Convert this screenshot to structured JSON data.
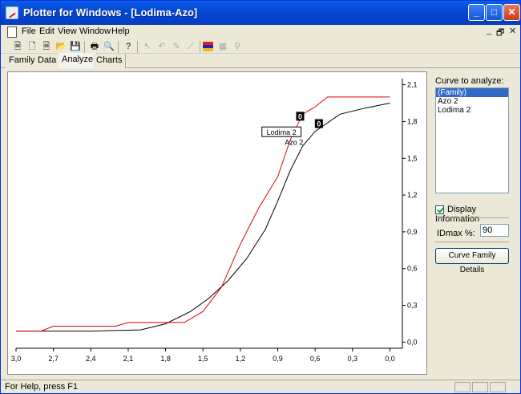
{
  "window": {
    "title": "Plotter for Windows - [Lodima-Azo]"
  },
  "titlebar_buttons": {
    "minimize": "_",
    "maximize": "□",
    "close": "✕"
  },
  "menu": [
    "File",
    "Edit",
    "View",
    "Window",
    "Help"
  ],
  "mdi_controls": [
    "_",
    "🗗",
    "✕"
  ],
  "toolbar_icons": [
    "new-family-icon",
    "new-icon",
    "new-sheet-icon",
    "open-icon",
    "save-icon",
    "print-icon",
    "print-preview-icon",
    "help-icon",
    "pointer-icon",
    "undo-icon",
    "add-point-icon",
    "draw-curve-icon",
    "color-palette-icon",
    "grid-icon",
    "zoom-icon"
  ],
  "tabs": [
    "Family",
    "Data",
    "Analyze",
    "Charts"
  ],
  "active_tab": "Analyze",
  "panel": {
    "curve_label": "Curve to analyze:",
    "curves": [
      "(Family)",
      "Azo 2",
      "Lodima 2"
    ],
    "selected_curve": "(Family)",
    "display_info_label": "Display Information",
    "display_info_checked": true,
    "idmax_label": "IDmax %:",
    "idmax_value": "90",
    "details_button": "Curve Family Details"
  },
  "status": {
    "text": "For Help, press F1"
  },
  "colors": {
    "title_blue": "#0548d4",
    "series_black": "#000000",
    "series_red": "#e00000",
    "selection": "#316ac5"
  },
  "chart_data": {
    "type": "line",
    "title": "",
    "xlabel": "",
    "ylabel": "",
    "xlim": [
      3.0,
      -0.1
    ],
    "ylim": [
      -0.05,
      2.15
    ],
    "x_ticks": [
      "3,0",
      "2,7",
      "2,4",
      "2,1",
      "1,8",
      "1,5",
      "1,2",
      "0,9",
      "0,6",
      "0,3",
      "0,0"
    ],
    "x_tick_values": [
      3.0,
      2.7,
      2.4,
      2.1,
      1.8,
      1.5,
      1.2,
      0.9,
      0.6,
      0.3,
      0.0
    ],
    "y_ticks": [
      "2,1",
      "1,8",
      "1,5",
      "1,2",
      "0,9",
      "0,6",
      "0,3",
      "0,0"
    ],
    "y_tick_values": [
      2.1,
      1.8,
      1.5,
      1.2,
      0.9,
      0.6,
      0.3,
      0.0
    ],
    "grid": false,
    "y_axis_side": "right",
    "series": [
      {
        "color": "#000000",
        "x": [
          3.0,
          2.7,
          2.4,
          2.0,
          1.8,
          1.6,
          1.45,
          1.3,
          1.15,
          1.0,
          0.9,
          0.8,
          0.7,
          0.6,
          0.4,
          0.2,
          0.0
        ],
        "y": [
          0.09,
          0.09,
          0.09,
          0.1,
          0.15,
          0.25,
          0.36,
          0.5,
          0.68,
          0.92,
          1.15,
          1.4,
          1.6,
          1.72,
          1.86,
          1.91,
          1.95
        ]
      },
      {
        "color": "#e00000",
        "x": [
          3.0,
          2.8,
          2.7,
          2.4,
          2.2,
          2.1,
          1.8,
          1.65,
          1.5,
          1.35,
          1.2,
          1.05,
          0.9,
          0.8,
          0.7,
          0.6,
          0.5,
          0.3,
          0.0
        ],
        "y": [
          0.09,
          0.09,
          0.13,
          0.13,
          0.13,
          0.16,
          0.16,
          0.16,
          0.25,
          0.45,
          0.8,
          1.1,
          1.35,
          1.65,
          1.86,
          1.92,
          2.0,
          2.0,
          2.0
        ]
      }
    ],
    "annotations": [
      {
        "text": "Lodima 2",
        "x": 0.87,
        "y": 1.71,
        "style": "box"
      },
      {
        "text": "Azo 2",
        "x": 0.77,
        "y": 1.63,
        "style": "plain"
      },
      {
        "text": "0",
        "x": 0.72,
        "y": 1.84,
        "style": "dark"
      },
      {
        "text": "0",
        "x": 0.57,
        "y": 1.78,
        "style": "dark"
      }
    ]
  }
}
